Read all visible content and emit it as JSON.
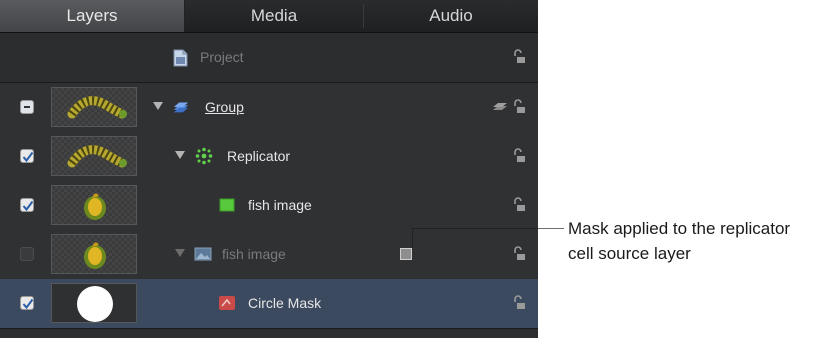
{
  "tabs": [
    {
      "label": "Layers",
      "active": true
    },
    {
      "label": "Media",
      "active": false
    },
    {
      "label": "Audio",
      "active": false
    }
  ],
  "rows": [
    {
      "label": "Project",
      "type": "project",
      "icon": "project-document-icon",
      "dimmed": true
    },
    {
      "label": "Group",
      "type": "group",
      "checkbox": "mixed",
      "thumbnail": "caterpillar",
      "expanded": true,
      "icon": "group-stack-icon",
      "underlined": true
    },
    {
      "label": "Replicator",
      "type": "replicator",
      "checkbox": "checked",
      "thumbnail": "caterpillar",
      "expanded": true,
      "icon": "replicator-icon"
    },
    {
      "label": "fish image",
      "type": "image",
      "checkbox": "checked",
      "thumbnail": "fish",
      "icon": "green-image-icon"
    },
    {
      "label": "fish image",
      "type": "image",
      "checkbox": "unchecked",
      "thumbnail": "fish",
      "expanded": true,
      "icon": "image-layer-icon",
      "dimmed": true
    },
    {
      "label": "Circle Mask",
      "type": "mask",
      "checkbox": "checked",
      "thumbnail": "white-circle",
      "icon": "mask-icon",
      "selected": true
    }
  ],
  "callout": {
    "line1": "Mask applied to the replicator",
    "line2": "cell source layer"
  },
  "colors": {
    "panel_bg": "#2e2f31",
    "selected_row": "#3b4a5e",
    "active_tab": "#4e4f52"
  }
}
